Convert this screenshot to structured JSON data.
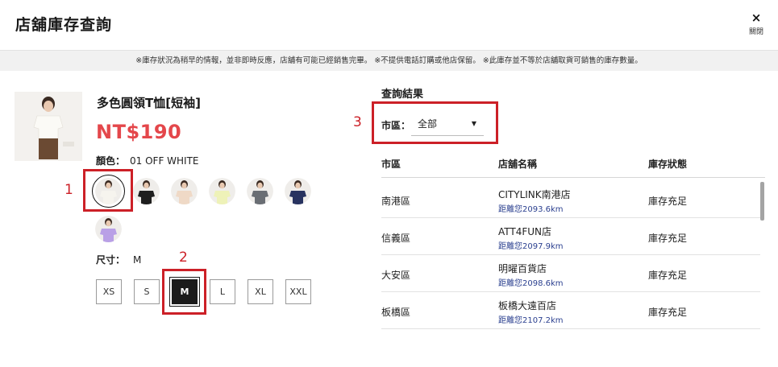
{
  "header": {
    "title": "店舖庫存查詢",
    "close_icon": "×",
    "close_label": "關閉"
  },
  "notice": "※庫存狀況為稍早的情報，並非即時反應，店舖有可能已經銷售完畢。 ※不提供電話訂購或他店保留。 ※此庫存並不等於店舖取貨可銷售的庫存數量。",
  "product": {
    "name": "多色圓領T恤[短袖]",
    "price": "NT$190",
    "color_label": "顏色：",
    "color_value": "01 OFF WHITE",
    "swatches": [
      {
        "shirt": "#f6f4ee",
        "selected": true
      },
      {
        "shirt": "#1e1e1e",
        "selected": false
      },
      {
        "shirt": "#efd9c6",
        "selected": false
      },
      {
        "shirt": "#eef2b8",
        "selected": false
      },
      {
        "shirt": "#6a6e74",
        "selected": false
      },
      {
        "shirt": "#283360",
        "selected": false
      },
      {
        "shirt": "#b9a0e6",
        "selected": false
      }
    ],
    "size_label": "尺寸：",
    "size_value": "M",
    "sizes": [
      "XS",
      "S",
      "M",
      "L",
      "XL",
      "XXL"
    ],
    "selected_size": "M"
  },
  "annotations": [
    "1",
    "2",
    "3"
  ],
  "results": {
    "title": "查詢結果",
    "filter_label": "市區：",
    "filter_value": "全部",
    "columns": [
      "市區",
      "店舖名稱",
      "庫存狀態"
    ],
    "rows": [
      {
        "area": "南港區",
        "store": "CITYLINK南港店",
        "distance": "距離您2093.6km",
        "stock": "庫存充足"
      },
      {
        "area": "信義區",
        "store": "ATT4FUN店",
        "distance": "距離您2097.9km",
        "stock": "庫存充足"
      },
      {
        "area": "大安區",
        "store": "明曜百貨店",
        "distance": "距離您2098.6km",
        "stock": "庫存充足"
      },
      {
        "area": "板橋區",
        "store": "板橋大遠百店",
        "distance": "距離您2107.2km",
        "stock": "庫存充足"
      }
    ]
  },
  "colors": {
    "price": "#e4474b",
    "annotation": "#cc2027",
    "distance": "#2a3f8f"
  }
}
